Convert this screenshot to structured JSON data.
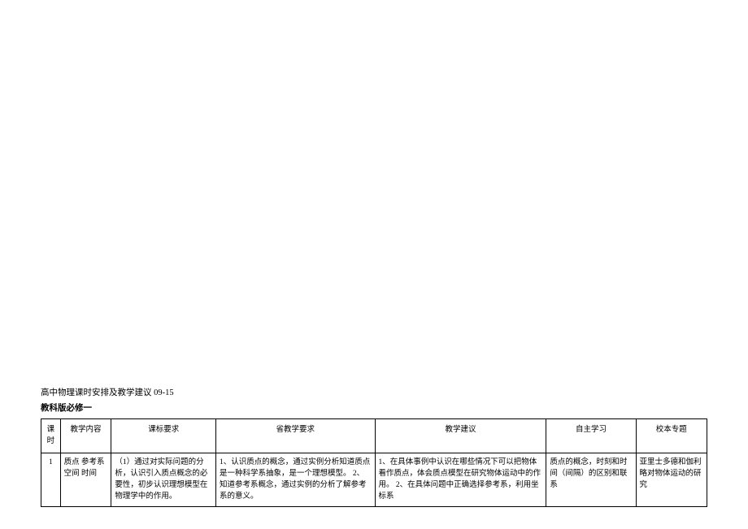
{
  "doc": {
    "title": "高中物理课时安排及教学建议 09-15",
    "subtitle": "教科版必修一"
  },
  "table": {
    "headers": {
      "index": "课时",
      "content": "教学内容",
      "standard": "课标要求",
      "province": "省教学要求",
      "suggest": "教学建议",
      "self": "自主学习",
      "school": "校本专题"
    },
    "rows": [
      {
        "index": "1",
        "content": "质点 参考系 空间 时间",
        "standard": "（1）通过对实际问题的分析，认识引入质点概念的必要性，初步认识理想模型在物理学中的作用。",
        "province": "1、认识质点的概念，通过实例分析知道质点是一种科学系抽象，是一个理想模型。\n2、知道参考系概念，通过实例的分析了解参考系的意义。",
        "suggest": "1、在具体事例中认识在哪些情况下可以把物体看作质点，体会质点模型在研究物体运动中的作用。\n2、在具体问题中正确选择参考系，利用坐标系",
        "self": "质点的概念，时刻和时间（间隔）的区别和联系",
        "school": "亚里士多德和伽利略对物体运动的研究"
      }
    ]
  }
}
